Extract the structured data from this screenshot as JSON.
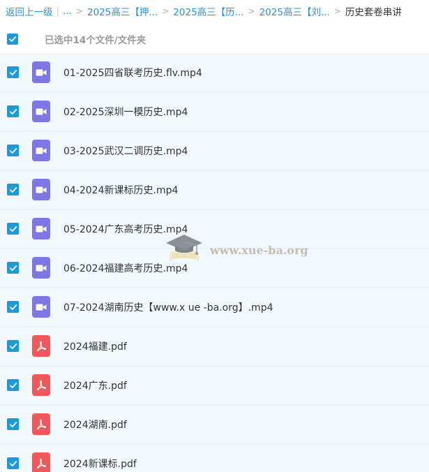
{
  "breadcrumb": {
    "back": "返回上一级",
    "ellipsis": "...",
    "items": [
      "2025高三【押...",
      "2025高三【历...",
      "2025高三【刘..."
    ],
    "current": "历史套卷串讲",
    "separator": ">",
    "divider": "|"
  },
  "selection": {
    "summary": "已选中14个文件/文件夹"
  },
  "files": [
    {
      "name": "01-2025四省联考历史.flv.mp4",
      "type": "video"
    },
    {
      "name": "02-2025深圳一模历史.mp4",
      "type": "video"
    },
    {
      "name": "03-2025武汉二调历史.mp4",
      "type": "video"
    },
    {
      "name": "04-2024新课标历史.mp4",
      "type": "video"
    },
    {
      "name": "05-2024广东高考历史.mp4",
      "type": "video"
    },
    {
      "name": "06-2024福建高考历史.mp4",
      "type": "video"
    },
    {
      "name": "07-2024湖南历史【www.x ue -ba.org】.mp4",
      "type": "video"
    },
    {
      "name": "2024福建.pdf",
      "type": "pdf"
    },
    {
      "name": "2024广东.pdf",
      "type": "pdf"
    },
    {
      "name": "2024湖南.pdf",
      "type": "pdf"
    },
    {
      "name": "2024新课标.pdf",
      "type": "pdf"
    }
  ],
  "watermark": {
    "text": "www.xue-ba.org"
  },
  "colors": {
    "link": "#2d8fd5",
    "checkbox": "#1e98d7",
    "row_background": "#f2f9fe",
    "video_icon": "#7f76e6",
    "pdf_icon": "#f0595b"
  }
}
